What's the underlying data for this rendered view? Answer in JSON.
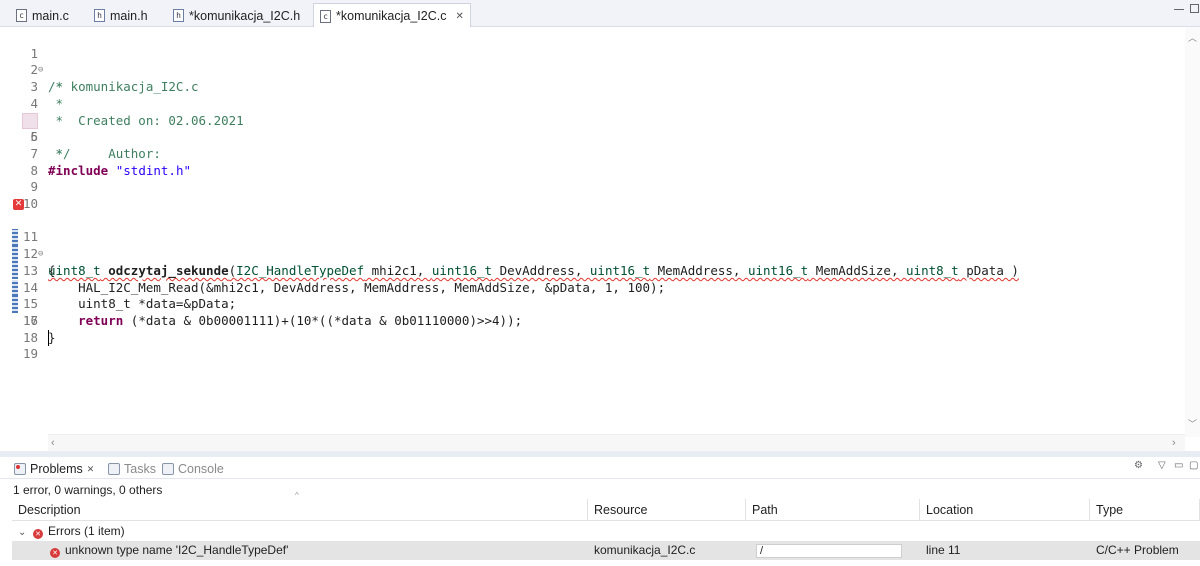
{
  "tabs": [
    {
      "label": "main.c",
      "icon": "c-file-icon",
      "active": false
    },
    {
      "label": "main.h",
      "icon": "h-file-icon",
      "active": false
    },
    {
      "label": "*komunikacja_I2C.h",
      "icon": "h-file-icon",
      "active": false
    },
    {
      "label": "*komunikacja_I2C.c",
      "icon": "c-file-icon",
      "active": true
    }
  ],
  "code": {
    "lines": [
      {
        "n": "1",
        "fold": "⊖",
        "text": "/*"
      },
      {
        "n": "2",
        "text": " * komunikacja_I2C.c"
      },
      {
        "n": "3",
        "text": " *"
      },
      {
        "n": "4",
        "text": " *  Created on: 02.06.2021"
      },
      {
        "n": "5",
        "text": " *      Author: "
      },
      {
        "n": "6",
        "text": " */"
      },
      {
        "n": "7",
        "kw": "#include",
        "str": " \"stdint.h\""
      },
      {
        "n": "8"
      },
      {
        "n": "9"
      },
      {
        "n": "10"
      },
      {
        "n": "11",
        "fold": "⊖"
      },
      {
        "n": "12",
        "text": "{"
      },
      {
        "n": "13",
        "text": "    HAL_I2C_Mem_Read(&mhi2c1, DevAddress, MemAddress, MemAddSize, &pData, 1, 100);"
      },
      {
        "n": "14",
        "text": "    uint8_t *data=&pData;"
      },
      {
        "n": "15",
        "kw": "    return",
        "text": " (*data & 0b00001111)+(10*((*data & 0b01110000)>>4));"
      },
      {
        "n": "16",
        "text": "}"
      },
      {
        "n": "17"
      },
      {
        "n": "18"
      },
      {
        "n": "19"
      }
    ],
    "line11": {
      "ret_type": "uint8_t",
      "fn_name": " odczytaj_sekunde",
      "open": "(",
      "t1": "I2C_HandleTypeDef",
      "p1": " mhi2c1, ",
      "t2": "uint16_t",
      "p2": " DevAddress, ",
      "t3": "uint16_t",
      "p3": " MemAddress, ",
      "t4": "uint16_t",
      "p4": " MemAddSize, ",
      "t5": "uint8_t",
      "p5": " pData )"
    }
  },
  "panel": {
    "tabs": [
      {
        "label": "Problems",
        "active": true
      },
      {
        "label": "Tasks",
        "active": false
      },
      {
        "label": "Console",
        "active": false
      }
    ],
    "summary": "1 error, 0 warnings, 0 others",
    "columns": [
      "Description",
      "Resource",
      "Path",
      "Location",
      "Type"
    ],
    "group_label": "Errors (1 item)",
    "row": {
      "description": "unknown type name 'I2C_HandleTypeDef'",
      "resource": "komunikacja_I2C.c",
      "path": "/",
      "location": "line 11",
      "type": "C/C++ Problem"
    }
  },
  "colors": {
    "comment": "#3f7f5f",
    "keyword": "#7f0055",
    "string": "#2a00ff",
    "type": "#005032",
    "error": "#e0332a"
  }
}
